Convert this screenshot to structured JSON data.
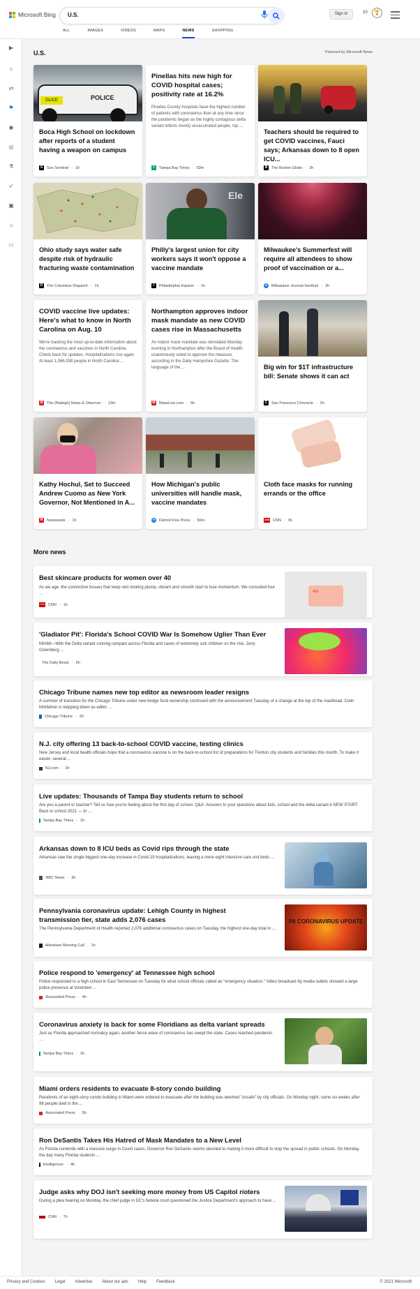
{
  "brand": {
    "name": "Microsoft Bing",
    "colors": [
      "#f25022",
      "#7fba00",
      "#00a4ef",
      "#ffb900"
    ]
  },
  "search": {
    "query": "U.S."
  },
  "header": {
    "signin": "Sign in",
    "rewards": "10"
  },
  "tabs": [
    "ALL",
    "IMAGES",
    "VIDEOS",
    "MAPS",
    "NEWS",
    "SHOPPING"
  ],
  "active_tab": "NEWS",
  "section": {
    "title": "U.S.",
    "powered": "Powered by Microsoft News"
  },
  "cards": [
    {
      "title": "Boca High School on lockdown after reports of a student having a weapon on campus",
      "source": "Sun Sentinel",
      "time": "1h",
      "icon": "S",
      "icon_color": "#000"
    },
    {
      "title": "Pinellas hits new high for COVID hospital cases; positivity rate at 16.2%",
      "snippet": "Pinellas County hospitals have the highest number of patients with coronavirus than at any time since the pandemic began as the highly contagious delta variant infects mostly unvaccinated people, top ...",
      "source": "Tampa Bay Times",
      "time": "53m",
      "icon": "t",
      "icon_color": "#00a36c"
    },
    {
      "title": "Teachers should be required to get COVID vaccines, Fauci says; Arkansas down to 8 open ICU...",
      "source": "The Boston Globe",
      "time": "2h",
      "icon": "B",
      "icon_color": "#000"
    },
    {
      "title": "Ohio study says water safe despite risk of hydraulic fracturing waste contamination",
      "source": "The Columbus Dispatch",
      "time": "1h",
      "icon": "D",
      "icon_color": "#000"
    },
    {
      "title": "Philly's largest union for city workers says it won't oppose a vaccine mandate",
      "source": "Philadelphia Inquirer",
      "time": "1h",
      "icon": "I",
      "icon_color": "#000"
    },
    {
      "title": "Milwaukee's Summerfest will require all attendees to show proof of vaccination or a...",
      "source": "Milwaukee Journal-Sentinel",
      "time": "2h",
      "icon": "●",
      "icon_color": "#2a7ae2"
    },
    {
      "title": "COVID vaccine live updates: Here's what to know in North Carolina on Aug. 10",
      "snippet": "We're tracking the most up-to-date information about the coronavirus and vaccines in North Carolina. Check back for updates. Hospitalizations rise again At least 1,086,938 people in North Carolina ...",
      "source": "The (Raleigh) News & Observer",
      "time": "13m",
      "icon": "N",
      "icon_color": "#d22"
    },
    {
      "title": "Northampton approves indoor mask mandate as new COVID cases rise in Massachusetts",
      "snippet": "An indoor mask mandate was reinstated Monday evening in Northampton after the Board of Health unanimously voted to approve the measure, according to the Daily Hampshire Gazette. The language of the ...",
      "source": "MassLive.com",
      "time": "5h",
      "icon": "M",
      "icon_color": "#d22"
    },
    {
      "title": "Big win for $1T infrastructure bill: Senate shows it can act",
      "source": "San Francisco Chronicle",
      "time": "2h",
      "icon": "C",
      "icon_color": "#000"
    },
    {
      "title": "Kathy Hochul, Set to Succeed Andrew Cuomo as New York Governor, Not Mentioned in A...",
      "source": "Newsweek",
      "time": "1h",
      "icon": "N",
      "icon_color": "#e11"
    },
    {
      "title": "How Michigan's public universities will handle mask, vaccine mandates",
      "source": "Detroit Free Press",
      "time": "56m",
      "icon": "●",
      "icon_color": "#2a7ae2"
    },
    {
      "title": "Cloth face masks for running errands or the office",
      "source": "CNN",
      "time": "3h",
      "icon": "CNN",
      "icon_color": "#c00"
    }
  ],
  "more_news": {
    "title": "More news",
    "items": [
      {
        "title": "Best skincare products for women over 40",
        "snippet": "As we age, the connective tissues that keep skin looking plump, vibrant and smooth start to lose momentum. We consulted four ...",
        "source": "CNN",
        "time": "1h",
        "icon": "CNN",
        "icon_color": "#c00",
        "image_label": "456"
      },
      {
        "title": "'Gladiator Pit': Florida's School COVID War Is Somehow Uglier Than Ever",
        "snippet": "MIAMI—With the Delta variant running rampant across Florida and cases of extremely sick children on the rise, Jerry Greenberg ...",
        "source": "The Daily Beast",
        "time": "9h",
        "icon": "",
        "icon_color": "#f4a09a"
      },
      {
        "title": "Chicago Tribune names new top editor as newsroom leader resigns",
        "snippet": "A summer of transition for the Chicago Tribune under new hedge fund ownership continued with the announcement Tuesday of a change at the top of the masthead. Colin McMahon is stepping down as editor ...",
        "source": "Chicago Tribune",
        "time": "2h",
        "icon": "C",
        "icon_color": "#2560c8"
      },
      {
        "title": "N.J. city offering 13 back-to-school COVID vaccine, testing clinics",
        "snippet": "New Jersey and local health officials hope that a coronavirus vaccine is on the back-to-school list of preparations for Trenton city students and families this month. To make it easier, several ...",
        "source": "NJ.com",
        "time": "1h",
        "icon": "NJ",
        "icon_color": "#333"
      },
      {
        "title": "Live updates: Thousands of Tampa Bay students return to school",
        "snippet": "Are you a parent or teacher? Tell us how you're feeling about the first day of school. Q&A: Answers to your questions about kids, school and the delta variant A NEW START: Back to school 2021 — In ...",
        "source": "Tampa Bay Times",
        "time": "1h",
        "icon": "t",
        "icon_color": "#00a36c"
      },
      {
        "title": "Arkansas down to 8 ICU beds as Covid rips through the state",
        "snippet": "Arkansas saw the single biggest one-day increase in Covid-19 hospitalizations, leaving a mere eight intensive care unit beds ...",
        "source": "NBC News",
        "time": "3h",
        "icon": "▲",
        "icon_color": "#555"
      },
      {
        "title": "Pennsylvania coronavirus update: Lehigh County in highest transmission tier, state adds 2,076 cases",
        "snippet": "The Pennsylvania Department of Health reported 2,076 additional coronavirus cases on Tuesday, the highest one-day total in ...",
        "source": "Allentown Morning Call",
        "time": "1h",
        "icon": "M",
        "icon_color": "#000",
        "image_label": "PA CORONAVIRUS UPDATE"
      },
      {
        "title": "Police respond to 'emergency' at Tennessee high school",
        "snippet": "Police responded to a high school in East Tennessee on Tuesday for what school officials called an \"emergency situation.\" Video broadcast by media outlets showed a large police presence at Volunteer ...",
        "source": "Associated Press",
        "time": "4h",
        "icon": "AP",
        "icon_color": "#e22"
      },
      {
        "title": "Coronavirus anxiety is back for some Floridians as delta variant spreads",
        "snippet": "Just as Florida approached normalcy again, another fierce wave of coronavirus has swept the state. Cases reached pandemic ...",
        "source": "Tampa Bay Times",
        "time": "2h",
        "icon": "t",
        "icon_color": "#00a36c"
      },
      {
        "title": "Miami orders residents to evacuate 8-story condo building",
        "snippet": "Residents of an eight-story condo building in Miami were ordered to evacuate after the building was deemed \"unsafe\" by city officials. On Monday night, some six weeks after 98 people died in the ...",
        "source": "Associated Press",
        "time": "5h",
        "icon": "AP",
        "icon_color": "#e22"
      },
      {
        "title": "Ron DeSantis Takes His Hatred of Mask Mandates to a New Level",
        "snippet": "As Florida contends with a massive surge in Covid cases, Governor Ron DeSantis seems devoted to making it more difficult to stop the spread in public schools. On Monday, the day many Florida students ...",
        "source": "Intelligencer",
        "time": "4h",
        "icon": "I",
        "icon_color": "#000"
      },
      {
        "title": "Judge asks why DOJ isn't seeking more money from US Capitol rioters",
        "snippet": "During a plea hearing on Monday, the chief judge in DC's federal court questioned the Justice Department's approach to have ...",
        "source": "CNN",
        "time": "7h",
        "icon": "CNN",
        "icon_color": "#c00"
      }
    ]
  },
  "footer": {
    "links": [
      "Privacy and Cookies",
      "Legal",
      "Advertise",
      "About our ads",
      "Help",
      "Feedback"
    ],
    "copyright": "© 2021 Microsoft"
  }
}
